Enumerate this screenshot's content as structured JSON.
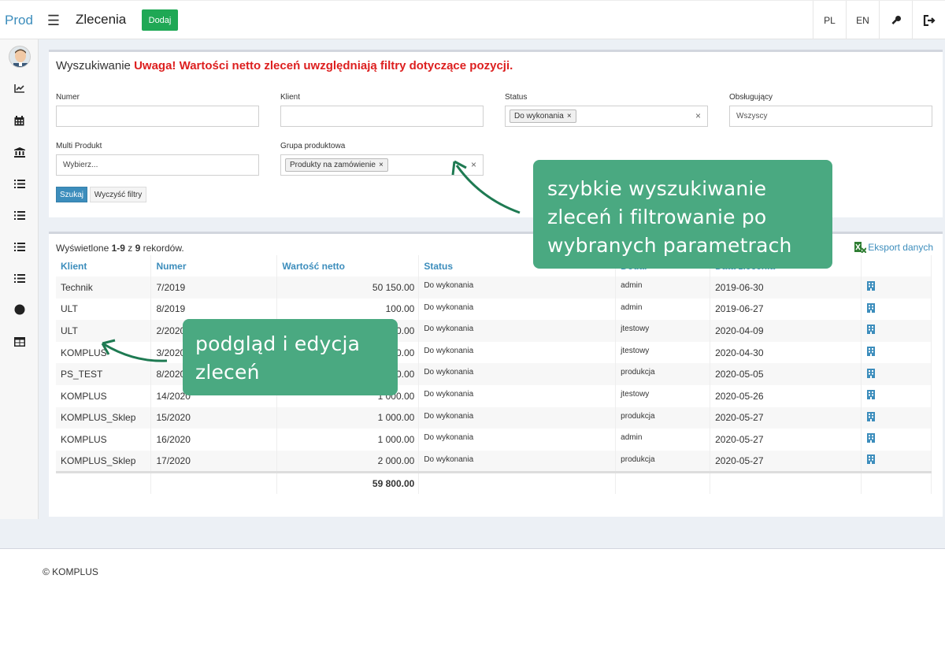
{
  "app": {
    "brand": "Prod",
    "page_title": "Zlecenia",
    "add_button": "Dodaj"
  },
  "topbar": {
    "lang_pl": "PL",
    "lang_en": "EN"
  },
  "search": {
    "header": "Wyszukiwanie",
    "warning": "Uwaga! Wartości netto zleceń uwzględniają filtry dotyczące pozycji.",
    "fields": {
      "numer_label": "Numer",
      "klient_label": "Klient",
      "status_label": "Status",
      "status_tag": "Do wykonania",
      "obslugujacy_label": "Obsługujący",
      "obslugujacy_value": "Wszyscy",
      "multi_label": "Multi Produkt",
      "multi_placeholder": "Wybierz...",
      "grupa_label": "Grupa produktowa",
      "grupa_tag": "Produkty na zamówienie"
    },
    "search_button": "Szukaj",
    "clear_button": "Wyczyść filtry"
  },
  "results": {
    "records_prefix": "Wyświetlone ",
    "records_range": "1-9",
    "records_of": " z ",
    "records_total": "9",
    "records_suffix": " rekordów.",
    "export": "Eksport danych",
    "columns": [
      "Klient",
      "Numer",
      "Wartość netto",
      "Status",
      "Dodał",
      "Data zlecenia"
    ],
    "rows": [
      {
        "klient": "Technik",
        "numer": "7/2019",
        "wartosc": "50 150.00",
        "status": "Do wykonania",
        "dodal": "admin",
        "data": "2019-06-30"
      },
      {
        "klient": "ULT",
        "numer": "8/2019",
        "wartosc": "100.00",
        "status": "Do wykonania",
        "dodal": "admin",
        "data": "2019-06-27"
      },
      {
        "klient": "ULT",
        "numer": "2/2020",
        "wartosc": "1 000.00",
        "status": "Do wykonania",
        "dodal": "jtestowy",
        "data": "2020-04-09"
      },
      {
        "klient": "KOMPLUS",
        "numer": "3/2020",
        "wartosc": "1 000.00",
        "status": "Do wykonania",
        "dodal": "jtestowy",
        "data": "2020-04-30"
      },
      {
        "klient": "PS_TEST",
        "numer": "8/2020",
        "wartosc": "2 550.00",
        "status": "Do wykonania",
        "dodal": "produkcja",
        "data": "2020-05-05"
      },
      {
        "klient": "KOMPLUS",
        "numer": "14/2020",
        "wartosc": "1 000.00",
        "status": "Do wykonania",
        "dodal": "jtestowy",
        "data": "2020-05-26"
      },
      {
        "klient": "KOMPLUS_Sklep",
        "numer": "15/2020",
        "wartosc": "1 000.00",
        "status": "Do wykonania",
        "dodal": "produkcja",
        "data": "2020-05-27"
      },
      {
        "klient": "KOMPLUS",
        "numer": "16/2020",
        "wartosc": "1 000.00",
        "status": "Do wykonania",
        "dodal": "admin",
        "data": "2020-05-27"
      },
      {
        "klient": "KOMPLUS_Sklep",
        "numer": "17/2020",
        "wartosc": "2 000.00",
        "status": "Do wykonania",
        "dodal": "produkcja",
        "data": "2020-05-27"
      }
    ],
    "total": "59 800.00"
  },
  "footer": {
    "copyright": "© KOMPLUS"
  },
  "annotations": {
    "callout1_line1": "szybkie wyszukiwanie",
    "callout1_line2": "zleceń i filtrowanie po",
    "callout1_line3": "wybranych parametrach",
    "callout2_line1": "podgląd i edycja",
    "callout2_line2": "zleceń"
  },
  "colors": {
    "accent": "#3c8dbc",
    "add_green": "#1fa855",
    "warning_red": "#dd1f1f",
    "callout_green": "#4aa981",
    "arrow_green": "#1e7a52"
  },
  "icons": [
    "hamburger-icon",
    "key-icon",
    "logout-icon",
    "chart-icon",
    "calendar-icon",
    "bank-icon",
    "list-icon",
    "circle-icon",
    "table-icon",
    "excel-icon",
    "building-icon"
  ]
}
